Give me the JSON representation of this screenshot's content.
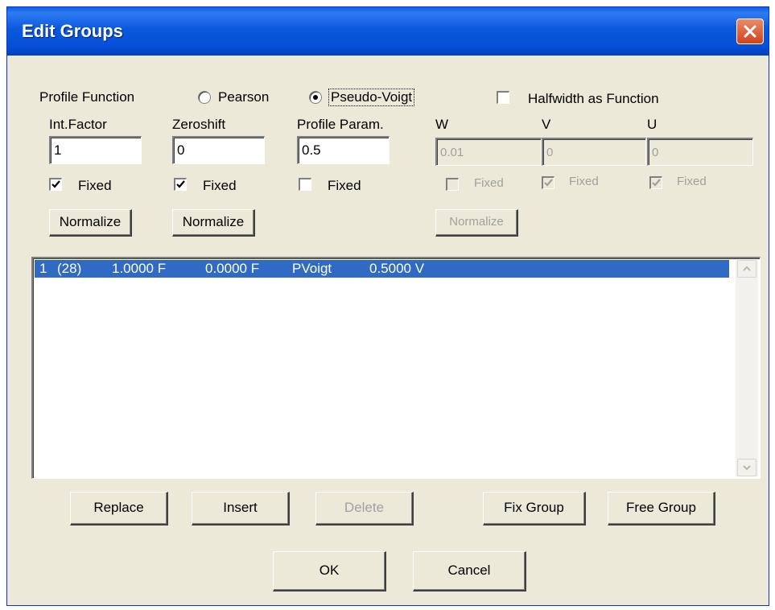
{
  "window": {
    "title": "Edit Groups"
  },
  "profile": {
    "label": "Profile Function",
    "options": [
      "Pearson",
      "Pseudo-Voigt"
    ],
    "selected": "Pseudo-Voigt",
    "halfwidth_label": "Halfwidth  as Function"
  },
  "params": {
    "int_factor": {
      "label": "Int.Factor",
      "value": "1",
      "fixed_label": "Fixed",
      "fixed": true,
      "normalize_label": "Normalize"
    },
    "zeroshift": {
      "label": "Zeroshift",
      "value": "0",
      "fixed_label": "Fixed",
      "fixed": true,
      "normalize_label": "Normalize"
    },
    "profile_param": {
      "label": "Profile Param.",
      "value": "0.5",
      "fixed_label": "Fixed",
      "fixed": false
    },
    "w": {
      "label": "W",
      "value": "0.01",
      "fixed_label": "Fixed",
      "fixed": false,
      "normalize_label": "Normalize"
    },
    "v": {
      "label": "V",
      "value": "0",
      "fixed_label": "Fixed",
      "fixed": true
    },
    "u": {
      "label": "U",
      "value": "0",
      "fixed_label": "Fixed",
      "fixed": true
    }
  },
  "list": {
    "rows": [
      {
        "index": "1",
        "count": "(28)",
        "int_factor": "1.0000 F",
        "zeroshift": "0.0000 F",
        "function": "PVoigt",
        "param": "0.5000 V"
      }
    ]
  },
  "buttons": {
    "replace": "Replace",
    "insert": "Insert",
    "delete": "Delete",
    "fix_group": "Fix Group",
    "free_group": "Free Group",
    "ok": "OK",
    "cancel": "Cancel"
  },
  "colors": {
    "titlebar": "#0A59DC",
    "dialog_bg": "#ECE9D8",
    "selection": "#316AC5",
    "close": "#D0421A"
  }
}
